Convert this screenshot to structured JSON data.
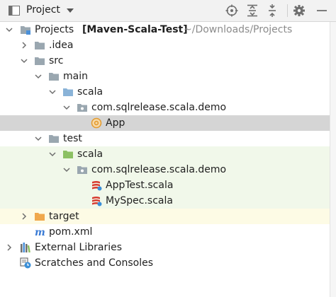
{
  "toolbar": {
    "title": "Project",
    "buttons": [
      "locate-icon",
      "expand-all-icon",
      "collapse-all-icon",
      "gear-icon",
      "hide-icon"
    ]
  },
  "colors": {
    "folder_blue": "#8ab3d8",
    "folder_gray": "#9aa7b0",
    "folder_green": "#8cc063",
    "folder_orange": "#f0a84c",
    "selected_row": "#d5d5d5",
    "test_bg": "#f1f8ea",
    "excluded_bg": "#fdfbe5"
  },
  "tree": {
    "root": {
      "name": "Projects",
      "bold": "[Maven-Scala-Test]",
      "path": "~/Downloads/Projects"
    },
    "idea": ".idea",
    "src": "src",
    "main": "main",
    "main_scala": "scala",
    "main_package": "com.sqlrelease.scala.demo",
    "app": "App",
    "test": "test",
    "test_scala": "scala",
    "test_package": "com.sqlrelease.scala.demo",
    "apptest": "AppTest.scala",
    "myspec": "MySpec.scala",
    "target": "target",
    "pom": "pom.xml",
    "external_libraries": "External Libraries",
    "scratches": "Scratches and Consoles"
  }
}
